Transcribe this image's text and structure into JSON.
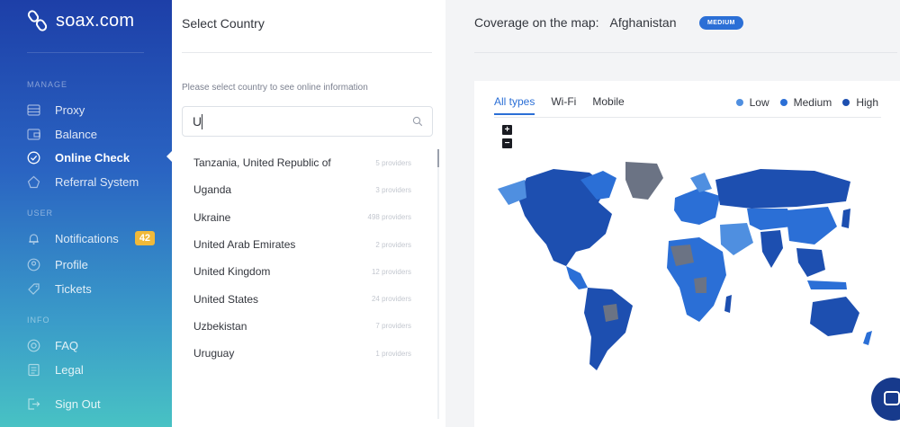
{
  "brand": {
    "name": "soax.com"
  },
  "sidebar": {
    "sections": {
      "manage": "MANAGE",
      "user": "USER",
      "info": "INFO"
    },
    "items": [
      {
        "label": "Proxy",
        "icon": "proxy-icon"
      },
      {
        "label": "Balance",
        "icon": "balance-icon"
      },
      {
        "label": "Online Check",
        "icon": "check-circle-icon",
        "active": true
      },
      {
        "label": "Referral System",
        "icon": "referral-icon"
      },
      {
        "label": "Notifications",
        "icon": "bell-icon",
        "badge": "42"
      },
      {
        "label": "Profile",
        "icon": "profile-icon"
      },
      {
        "label": "Tickets",
        "icon": "ticket-icon"
      },
      {
        "label": "FAQ",
        "icon": "faq-icon"
      },
      {
        "label": "Legal",
        "icon": "legal-icon"
      },
      {
        "label": "Sign Out",
        "icon": "sign-out-icon"
      }
    ]
  },
  "country_panel": {
    "title": "Select Country",
    "hint": "Please select country to see online information",
    "search": {
      "value": "U"
    },
    "countries": [
      {
        "name": "Tanzania, United Republic of",
        "providers": "5 providers"
      },
      {
        "name": "Uganda",
        "providers": "3 providers"
      },
      {
        "name": "Ukraine",
        "providers": "498 providers"
      },
      {
        "name": "United Arab Emirates",
        "providers": "2 providers"
      },
      {
        "name": "United Kingdom",
        "providers": "12 providers"
      },
      {
        "name": "United States",
        "providers": "24 providers"
      },
      {
        "name": "Uzbekistan",
        "providers": "7 providers"
      },
      {
        "name": "Uruguay",
        "providers": "1 providers"
      }
    ]
  },
  "coverage": {
    "label": "Coverage on the map:",
    "country": "Afghanistan",
    "level": "MEDIUM"
  },
  "map": {
    "tabs": [
      "All types",
      "Wi-Fi",
      "Mobile"
    ],
    "active_tab": "All types",
    "legend": [
      {
        "label": "Low",
        "color": "#4f8fe0"
      },
      {
        "label": "Medium",
        "color": "#2b6fd6"
      },
      {
        "label": "High",
        "color": "#1d4fb0"
      }
    ],
    "zoom_in": "+",
    "zoom_out": "−"
  },
  "colors": {
    "accent": "#2b6fd6",
    "badge": "#f0b93a",
    "map_no_data": "#6b7384"
  }
}
